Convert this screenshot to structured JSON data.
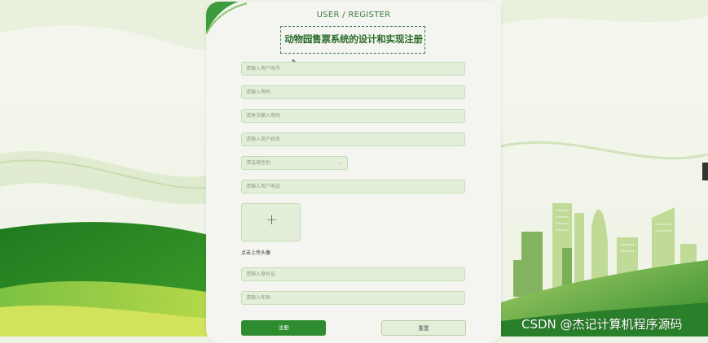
{
  "heading": "USER / REGISTER",
  "title": "动物园售票系统的设计和实现注册",
  "fields": {
    "account": "请输入用户账号",
    "password": "请输入密码",
    "confirm_password": "请再次输入密码",
    "name": "请输入用户姓名",
    "gender": "请选择性别",
    "phone": "请输入用户电话",
    "id_card": "请输入身份证",
    "age": "请输入年龄"
  },
  "upload": {
    "symbol": "+",
    "label": "点击上传头像"
  },
  "buttons": {
    "register": "注册",
    "reset": "重置"
  },
  "watermark": "CSDN @杰记计算机程序源码",
  "colors": {
    "accent": "#2e8b2e",
    "field_bg": "#e3efd9",
    "panel_bg": "#f4f5f1"
  }
}
